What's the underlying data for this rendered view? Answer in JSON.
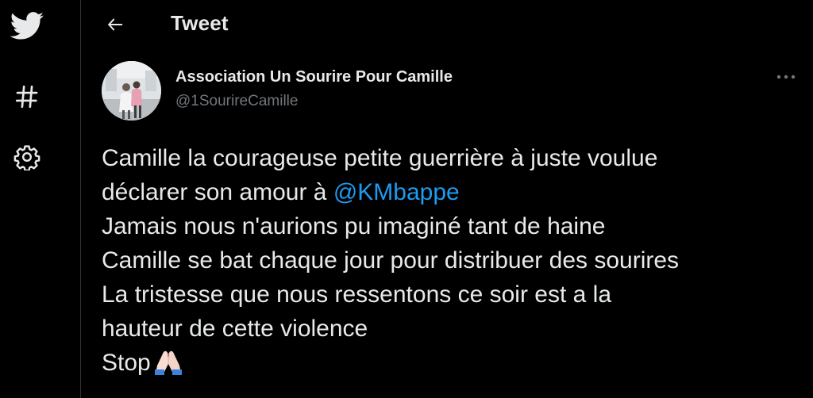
{
  "icons": {
    "logo": "twitter-bird-icon",
    "explore": "hashtag-icon",
    "settings": "gear-icon",
    "back": "arrow-left-icon",
    "more": "more-horizontal-icon",
    "emoji": "folded-hands-emoji"
  },
  "header": {
    "title": "Tweet"
  },
  "tweet": {
    "author": {
      "name": "Association Un Sourire Pour Camille",
      "handle": "@1SourireCamille"
    },
    "lines": {
      "l1": "Camille la courageuse petite guerrière à juste voulue",
      "l2_prefix": "déclarer son amour à ",
      "l2_mention": "@KMbappe",
      "l3": "Jamais nous n'aurions pu imaginé tant de haine",
      "l4": "Camille se bat chaque jour pour distribuer des sourires",
      "l5": "La tristesse que nous ressentons ce soir est a la",
      "l6": "hauteur de cette violence",
      "l7": "Stop"
    }
  },
  "colors": {
    "background": "#000000",
    "text": "#e7e9ea",
    "secondary_text": "#71767b",
    "accent": "#1d9bf0",
    "divider": "#2f3336"
  }
}
